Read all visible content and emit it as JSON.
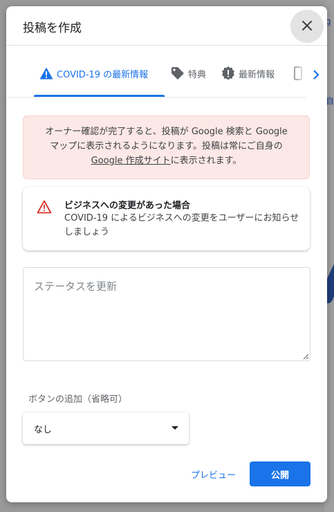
{
  "dialog": {
    "title": "投稿を作成",
    "close_icon": "close-icon"
  },
  "tabs": [
    {
      "label": "COVID-19 の最新情報",
      "icon": "warning-icon",
      "active": true
    },
    {
      "label": "特典",
      "icon": "tag-icon",
      "active": false
    },
    {
      "label": "最新情報",
      "icon": "badge-alert-icon",
      "active": false
    },
    {
      "label": "",
      "icon": "phone-icon",
      "active": false
    }
  ],
  "tabs_next_icon": "chevron-right-icon",
  "notice": {
    "text_line1": "オーナー確認が完了すると、投稿が Google 検索と Google",
    "text_line2": "マップに表示されるようになります。投稿は常にご自身の",
    "link_text": "Google 作成サイト",
    "text_after_link": "に表示されます。",
    "background_color": "#fce8e6"
  },
  "covid_card": {
    "icon": "warning-triangle-icon",
    "heading": "ビジネスへの変更があった場合",
    "body": "COVID-19 によるビジネスへの変更をユーザーにお知らせしましょう"
  },
  "status_input": {
    "placeholder": "ステータスを更新",
    "value": ""
  },
  "button_section": {
    "label": "ボタンの追加（省略可）",
    "selected": "なし"
  },
  "actions": {
    "preview_label": "プレビュー",
    "publish_label": "公開"
  },
  "colors": {
    "accent": "#1a73e8",
    "warning_red": "#d93025"
  }
}
